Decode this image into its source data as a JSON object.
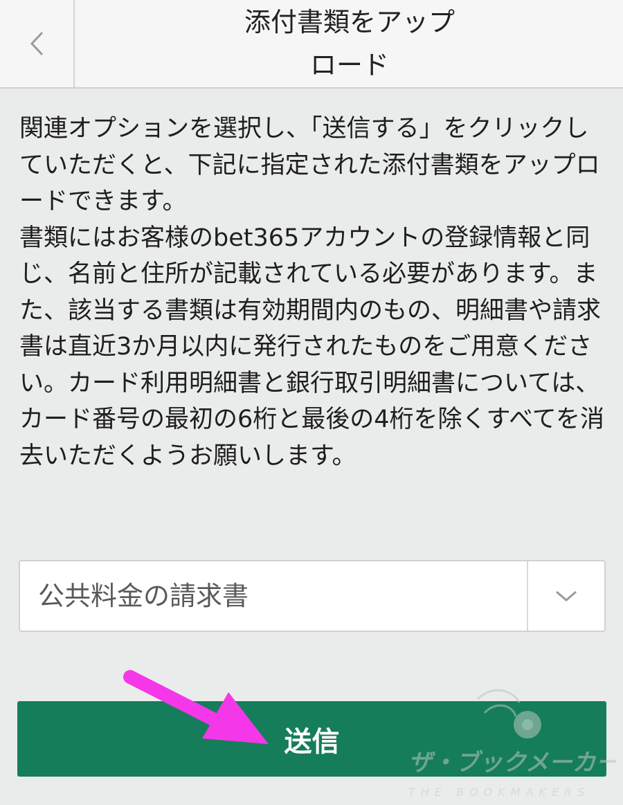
{
  "header": {
    "title": "添付書類をアップロード",
    "back_icon": "chevron-left-icon"
  },
  "instructions": {
    "paragraph_1": "関連オプションを選択し、「送信する」をクリックしていただくと、下記に指定された添付書類をアップロードできます。",
    "paragraph_2": "書類にはお客様のbet365アカウントの登録情報と同じ、名前と住所が記載されている必要があります。また、該当する書類は有効期間内のもの、明細書や請求書は直近3か月以内に発行されたものをご用意ください。カード利用明細書と銀行取引明細書については、カード番号の最初の6桁と最後の4桁を除くすべてを消去いただくようお願いします。"
  },
  "document_select": {
    "selected_value": "公共料金の請求書",
    "arrow_icon": "chevron-down-icon"
  },
  "submit": {
    "label": "送信"
  },
  "watermark": {
    "text": "ザ・ブックメーカーズ",
    "subtext": "THE BOOKMAKERS"
  },
  "colors": {
    "background": "#e9ecea",
    "header_background": "#f6f6f6",
    "submit_green": "#157d59",
    "annotation_magenta": "#f437e8"
  }
}
